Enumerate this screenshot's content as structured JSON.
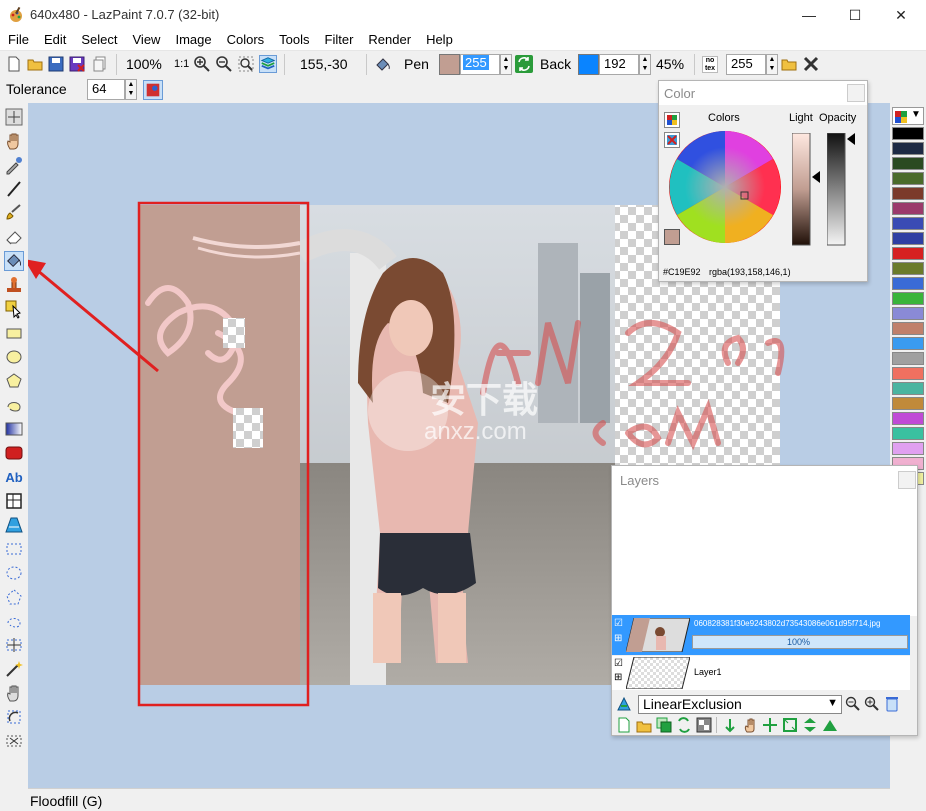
{
  "window": {
    "title": "640x480 - LazPaint 7.0.7 (32-bit)",
    "minimize": "—",
    "maximize": "☐",
    "close": "✕"
  },
  "menu": [
    "File",
    "Edit",
    "Select",
    "View",
    "Image",
    "Colors",
    "Tools",
    "Filter",
    "Render",
    "Help"
  ],
  "toolbar": {
    "zoom": "100%",
    "zoom_one": "1:1",
    "coords": "155,-30",
    "pen_label": "Pen",
    "pen_color": "#c19e92",
    "pen_alpha": "255",
    "back_label": "Back",
    "back_color": "#0a84ff",
    "back_alpha": "192",
    "opacity_percent": "45%",
    "notex_label": "no tex",
    "tex_alpha": "255"
  },
  "options": {
    "tolerance_label": "Tolerance",
    "tolerance_value": "64"
  },
  "status": "Floodfill (G)",
  "color_panel": {
    "title": "Color",
    "colors_label": "Colors",
    "light_label": "Light",
    "opacity_label": "Opacity",
    "hex": "#C19E92",
    "rgba": "rgba(193,158,146,1)"
  },
  "layers_panel": {
    "title": "Layers",
    "layer1_name": "060828381f30e9243802d73543086e061d95f714.jpg",
    "layer1_opacity": "100%",
    "layer2_name": "Layer1",
    "blend_mode": "LinearExclusion"
  },
  "watermark": {
    "line1": "安下载",
    "line2": "anxz.com"
  },
  "palette_colors": [
    "#000000",
    "#1e2a44",
    "#2b4a21",
    "#4a6b2a",
    "#7b3a2a",
    "#9b3a6b",
    "#3a4bb4",
    "#2f3fa3",
    "#d62020",
    "#6b7b2a",
    "#3a6bd6",
    "#3ab43a",
    "#8a8ad6",
    "#c0806b",
    "#3a9bf0",
    "#a0a0a0",
    "#f07060",
    "#4ab4a0",
    "#c08a3a",
    "#c04ad6",
    "#3ac0a0",
    "#e0a0f0",
    "#f0b0d0",
    "#f0f0a0"
  ],
  "colors": {
    "workspace": "#b9cde5",
    "selection_highlight": "#3399ff",
    "annotation_red": "#e02020"
  }
}
